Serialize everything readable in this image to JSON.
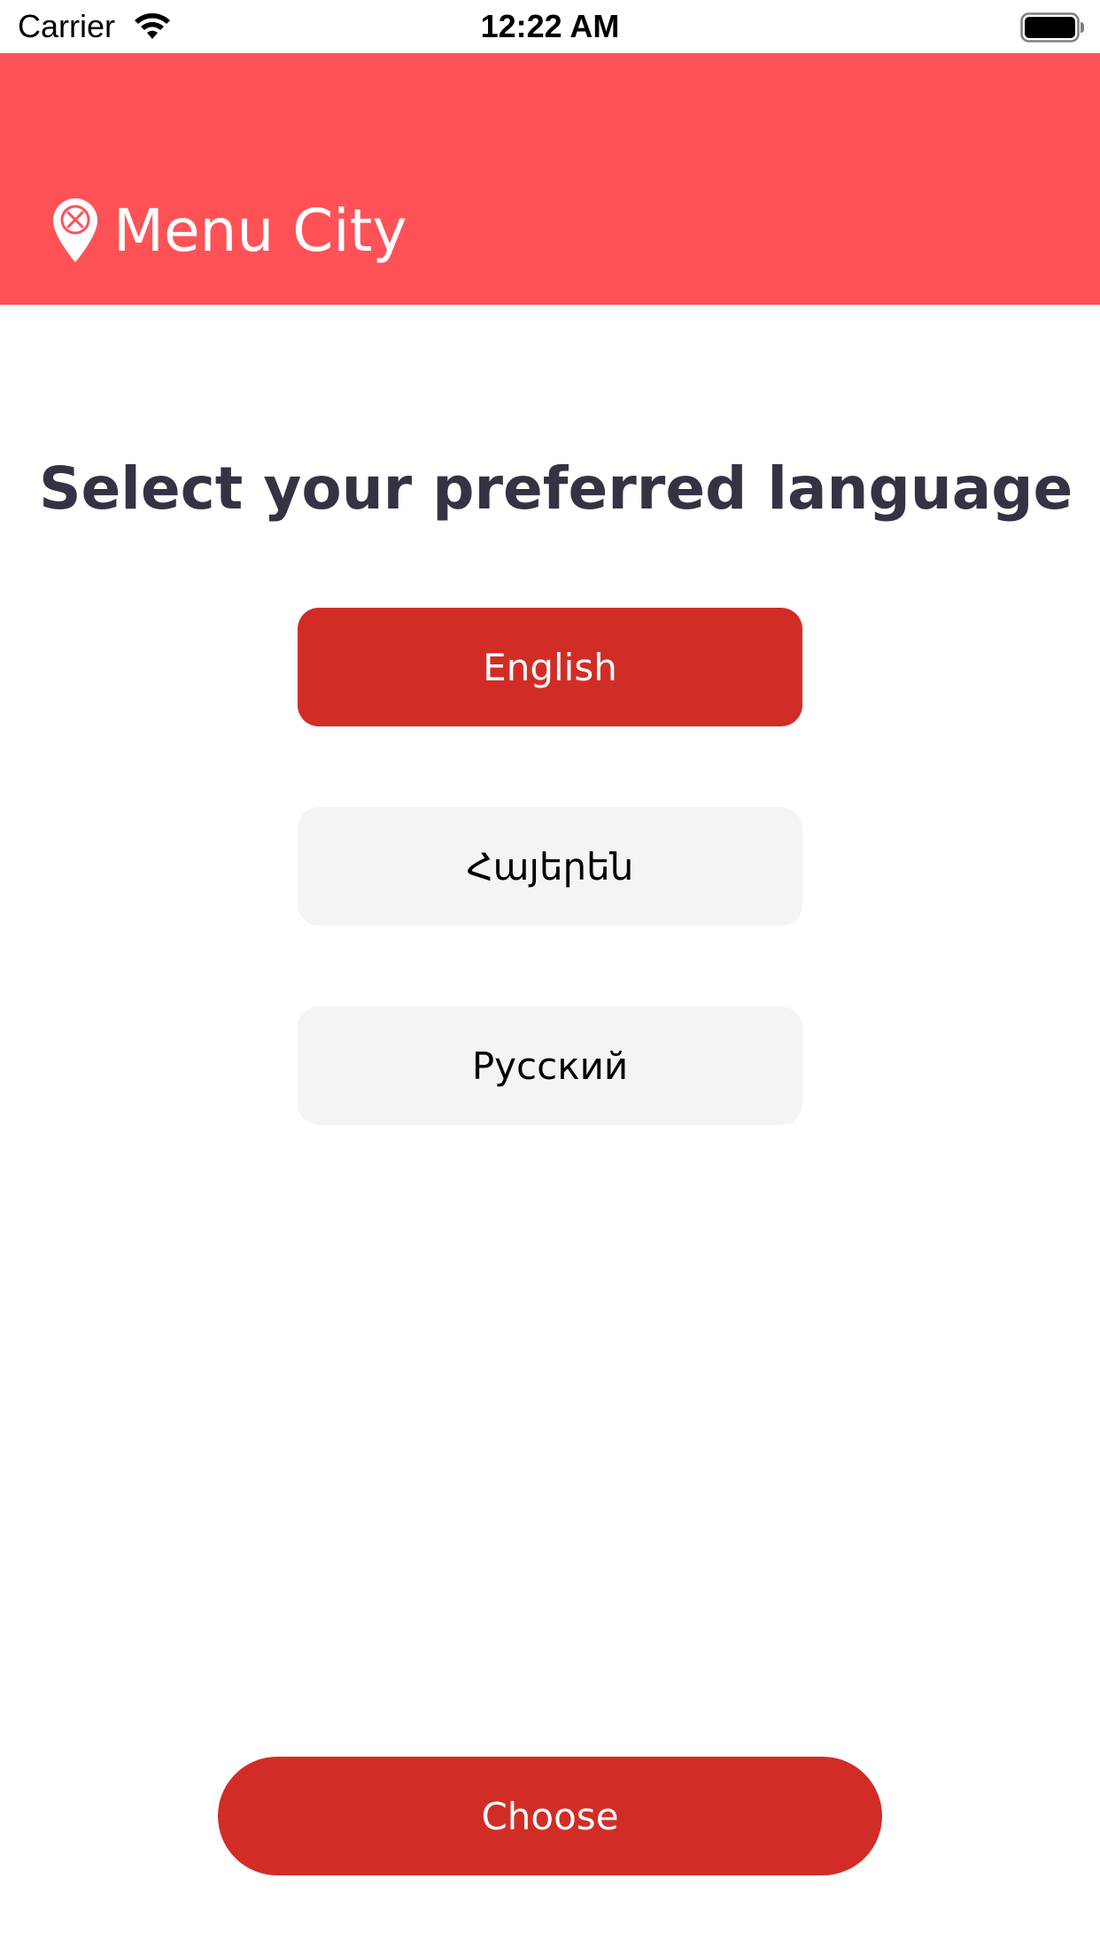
{
  "status_bar": {
    "carrier": "Carrier",
    "time": "12:22 AM",
    "wifi_icon": "wifi-icon",
    "battery_icon": "battery-icon"
  },
  "header": {
    "title": "Menu City",
    "logo_icon": "map-pin-fork-knife-icon",
    "background_color": "#FF5257"
  },
  "main": {
    "heading": "Select your preferred language",
    "languages": [
      {
        "label": "English",
        "selected": true
      },
      {
        "label": "Հայերեն",
        "selected": false
      },
      {
        "label": "Русский",
        "selected": false
      }
    ],
    "selected_color": "#D12D26",
    "unselected_color": "#F4F4F4"
  },
  "footer": {
    "choose_label": "Choose",
    "button_color": "#D12D26"
  }
}
